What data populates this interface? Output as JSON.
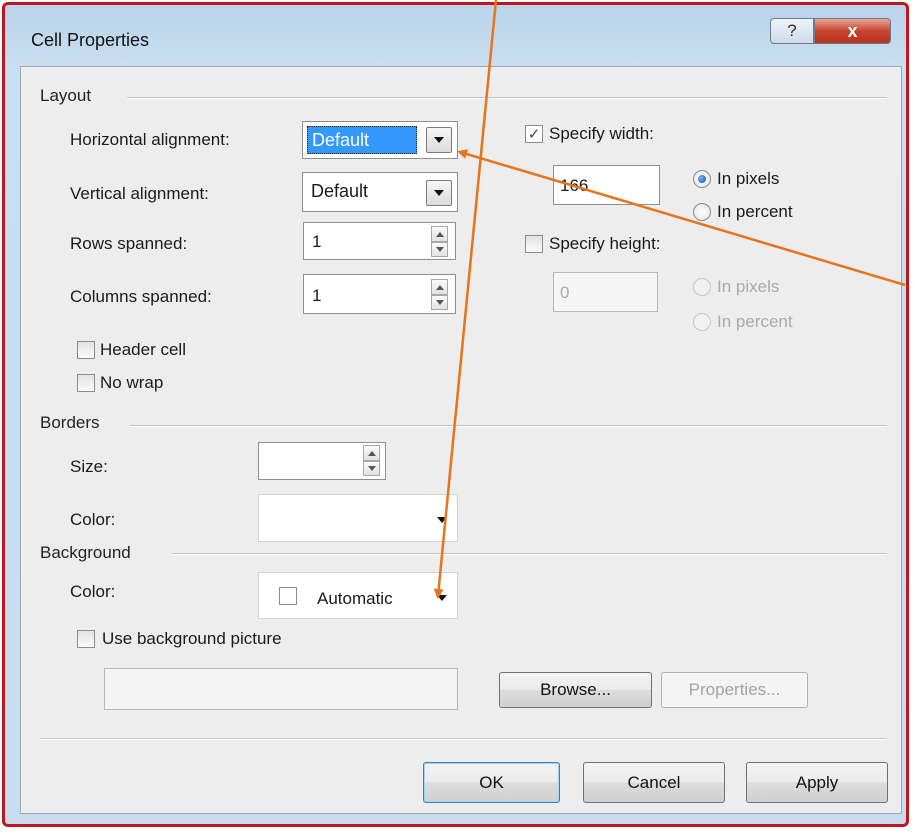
{
  "window": {
    "title": "Cell Properties",
    "help_glyph": "?",
    "close_glyph": "x"
  },
  "layout": {
    "group_label": "Layout",
    "horizontal_alignment": {
      "label": "Horizontal alignment:",
      "value": "Default"
    },
    "vertical_alignment": {
      "label": "Vertical alignment:",
      "value": "Default"
    },
    "rows_spanned": {
      "label": "Rows spanned:",
      "value": "1"
    },
    "columns_spanned": {
      "label": "Columns spanned:",
      "value": "1"
    },
    "header_cell": {
      "label": "Header cell",
      "checked": false
    },
    "no_wrap": {
      "label": "No wrap",
      "checked": false
    },
    "specify_width": {
      "label": "Specify width:",
      "checked": true,
      "value": "166",
      "check_glyph": "✓"
    },
    "width_units": {
      "pixels": "In pixels",
      "percent": "In percent",
      "selected": "In pixels"
    },
    "specify_height": {
      "label": "Specify height:",
      "checked": false,
      "value": "0"
    },
    "height_units": {
      "pixels": "In pixels",
      "percent": "In percent"
    }
  },
  "borders": {
    "group_label": "Borders",
    "size_label": "Size:",
    "size_value": "",
    "color_label": "Color:",
    "color_value": ""
  },
  "background": {
    "group_label": "Background",
    "color_label": "Color:",
    "color_value": "Automatic",
    "use_picture": {
      "label": "Use background picture",
      "checked": false
    },
    "picture_path": "",
    "browse_label": "Browse...",
    "properties_label": "Properties..."
  },
  "footer": {
    "ok_label": "OK",
    "cancel_label": "Cancel",
    "apply_label": "Apply"
  },
  "annotation_color": "#e8741a",
  "frame_color": "#c0161c"
}
